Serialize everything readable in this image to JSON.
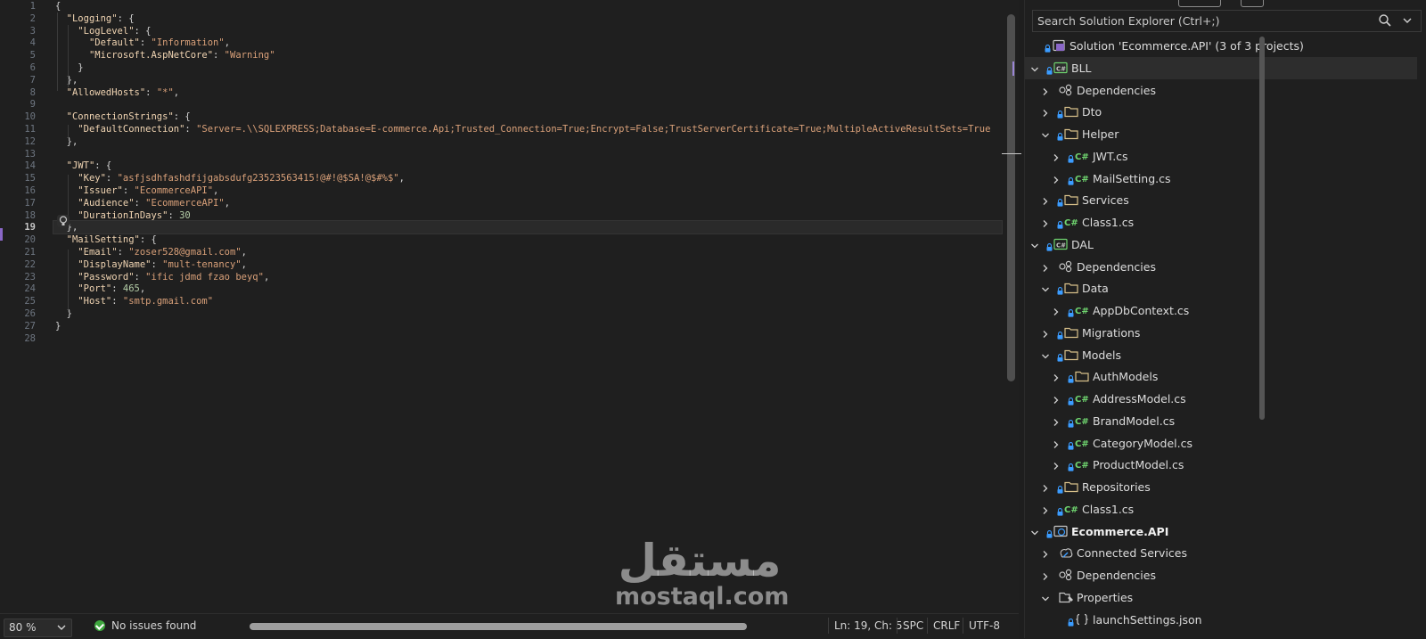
{
  "editor": {
    "lines": [
      {
        "n": "1",
        "html": "<span class='p'>{</span>"
      },
      {
        "n": "2",
        "html": "  <span class='k'>\"Logging\"</span><span class='p'>: {</span>"
      },
      {
        "n": "3",
        "html": "    <span class='k'>\"LogLevel\"</span><span class='p'>: {</span>"
      },
      {
        "n": "4",
        "html": "      <span class='k'>\"Default\"</span><span class='p'>: </span><span class='s'>\"Information\"</span><span class='p'>,</span>"
      },
      {
        "n": "5",
        "html": "      <span class='k'>\"Microsoft.AspNetCore\"</span><span class='p'>: </span><span class='s'>\"Warning\"</span>"
      },
      {
        "n": "6",
        "html": "    <span class='p'>}</span>"
      },
      {
        "n": "7",
        "html": "  <span class='p'>},</span>"
      },
      {
        "n": "8",
        "html": "  <span class='k'>\"AllowedHosts\"</span><span class='p'>: </span><span class='s'>\"*\"</span><span class='p'>,</span>"
      },
      {
        "n": "9",
        "html": ""
      },
      {
        "n": "10",
        "html": "  <span class='k'>\"ConnectionStrings\"</span><span class='p'>: {</span>"
      },
      {
        "n": "11",
        "html": "    <span class='k'>\"DefaultConnection\"</span><span class='p'>: </span><span class='s'>\"Server=.\\\\SQLEXPRESS;Database=E-commerce.Api;Trusted_Connection=True;Encrypt=False;TrustServerCertificate=True;MultipleActiveResultSets=True</span>"
      },
      {
        "n": "12",
        "html": "  <span class='p'>},</span>"
      },
      {
        "n": "13",
        "html": ""
      },
      {
        "n": "14",
        "html": "  <span class='k'>\"JWT\"</span><span class='p'>: {</span>"
      },
      {
        "n": "15",
        "html": "    <span class='k'>\"Key\"</span><span class='p'>: </span><span class='s'>\"asfjsdhfashdfijgabsdufg23523563415!@#!@$SA!@$#%$\"</span><span class='p'>,</span>"
      },
      {
        "n": "16",
        "html": "    <span class='k'>\"Issuer\"</span><span class='p'>: </span><span class='s'>\"EcommerceAPI\"</span><span class='p'>,</span>"
      },
      {
        "n": "17",
        "html": "    <span class='k'>\"Audience\"</span><span class='p'>: </span><span class='s'>\"EcommerceAPI\"</span><span class='p'>,</span>"
      },
      {
        "n": "18",
        "html": "    <span class='k'>\"DurationInDays\"</span><span class='p'>: </span><span class='n'>30</span>"
      },
      {
        "n": "19",
        "html": "  <span class='p'>},</span>",
        "current": true
      },
      {
        "n": "20",
        "html": "  <span class='k'>\"MailSetting\"</span><span class='p'>: {</span>"
      },
      {
        "n": "21",
        "html": "    <span class='k'>\"Email\"</span><span class='p'>: </span><span class='s'>\"zoser528@gmail.com\"</span><span class='p'>,</span>"
      },
      {
        "n": "22",
        "html": "    <span class='k'>\"DisplayName\"</span><span class='p'>: </span><span class='s'>\"mult-tenancy\"</span><span class='p'>,</span>"
      },
      {
        "n": "23",
        "html": "    <span class='k'>\"Password\"</span><span class='p'>: </span><span class='s'>\"ific jdmd fzao beyq\"</span><span class='p'>,</span>"
      },
      {
        "n": "24",
        "html": "    <span class='k'>\"Port\"</span><span class='p'>: </span><span class='n'>465</span><span class='p'>,</span>"
      },
      {
        "n": "25",
        "html": "    <span class='k'>\"Host\"</span><span class='p'>: </span><span class='s'>\"smtp.gmail.com\"</span>"
      },
      {
        "n": "26",
        "html": "  <span class='p'>}</span>"
      },
      {
        "n": "27",
        "html": "<span class='p'>}</span>"
      },
      {
        "n": "28",
        "html": ""
      }
    ]
  },
  "status": {
    "zoom": "80 %",
    "issues": "No issues found",
    "position": "Ln: 19, Ch: 5",
    "whitespace": "SPC",
    "line_ending": "CRLF",
    "encoding": "UTF-8"
  },
  "solution_explorer": {
    "search_placeholder": "Search Solution Explorer (Ctrl+;)",
    "items": [
      {
        "label": "Solution 'Ecommerce.API' (3 of 3 projects)",
        "depth": 0,
        "chev": "none",
        "icon": "solution-icon"
      },
      {
        "label": "BLL",
        "depth": 0,
        "chev": "down",
        "icon": "csproj-icon",
        "selected": true
      },
      {
        "label": "Dependencies",
        "depth": 1,
        "chev": "right",
        "icon": "dependencies-icon",
        "nolock": true
      },
      {
        "label": "Dto",
        "depth": 1,
        "chev": "right",
        "icon": "folder-icon"
      },
      {
        "label": "Helper",
        "depth": 1,
        "chev": "down",
        "icon": "folder-icon"
      },
      {
        "label": "JWT.cs",
        "depth": 2,
        "chev": "right",
        "icon": "csharp-icon"
      },
      {
        "label": "MailSetting.cs",
        "depth": 2,
        "chev": "right",
        "icon": "csharp-icon"
      },
      {
        "label": "Services",
        "depth": 1,
        "chev": "right",
        "icon": "folder-icon"
      },
      {
        "label": "Class1.cs",
        "depth": 1,
        "chev": "right",
        "icon": "csharp-icon"
      },
      {
        "label": "DAL",
        "depth": 0,
        "chev": "down",
        "icon": "csproj-icon"
      },
      {
        "label": "Dependencies",
        "depth": 1,
        "chev": "right",
        "icon": "dependencies-icon",
        "nolock": true
      },
      {
        "label": "Data",
        "depth": 1,
        "chev": "down",
        "icon": "folder-icon"
      },
      {
        "label": "AppDbContext.cs",
        "depth": 2,
        "chev": "right",
        "icon": "csharp-icon"
      },
      {
        "label": "Migrations",
        "depth": 1,
        "chev": "right",
        "icon": "folder-icon"
      },
      {
        "label": "Models",
        "depth": 1,
        "chev": "down",
        "icon": "folder-icon"
      },
      {
        "label": "AuthModels",
        "depth": 2,
        "chev": "right",
        "icon": "folder-icon"
      },
      {
        "label": "AddressModel.cs",
        "depth": 2,
        "chev": "right",
        "icon": "csharp-icon"
      },
      {
        "label": "BrandModel.cs",
        "depth": 2,
        "chev": "right",
        "icon": "csharp-icon"
      },
      {
        "label": "CategoryModel.cs",
        "depth": 2,
        "chev": "right",
        "icon": "csharp-icon"
      },
      {
        "label": "ProductModel.cs",
        "depth": 2,
        "chev": "right",
        "icon": "csharp-icon"
      },
      {
        "label": "Repositories",
        "depth": 1,
        "chev": "right",
        "icon": "folder-icon"
      },
      {
        "label": "Class1.cs",
        "depth": 1,
        "chev": "right",
        "icon": "csharp-icon"
      },
      {
        "label": "Ecommerce.API",
        "depth": 0,
        "chev": "down",
        "icon": "webproj-icon",
        "bold": true
      },
      {
        "label": "Connected Services",
        "depth": 1,
        "chev": "right",
        "icon": "connected-services-icon",
        "nolock": true
      },
      {
        "label": "Dependencies",
        "depth": 1,
        "chev": "right",
        "icon": "dependencies-icon",
        "nolock": true
      },
      {
        "label": "Properties",
        "depth": 1,
        "chev": "down",
        "icon": "properties-icon",
        "nolock": true
      },
      {
        "label": "launchSettings.json",
        "depth": 2,
        "chev": "none",
        "icon": "json-icon"
      }
    ]
  },
  "watermark": {
    "arabic": "مستقل",
    "latin": "mostaql.com"
  },
  "colors": {
    "key": "#f0d4b2",
    "string": "#d9a079",
    "number": "#b5cea8",
    "accent": "#8a67c7",
    "ok": "#3ea73e",
    "csharp": "#6fd46f",
    "lock": "#3b9cff"
  }
}
